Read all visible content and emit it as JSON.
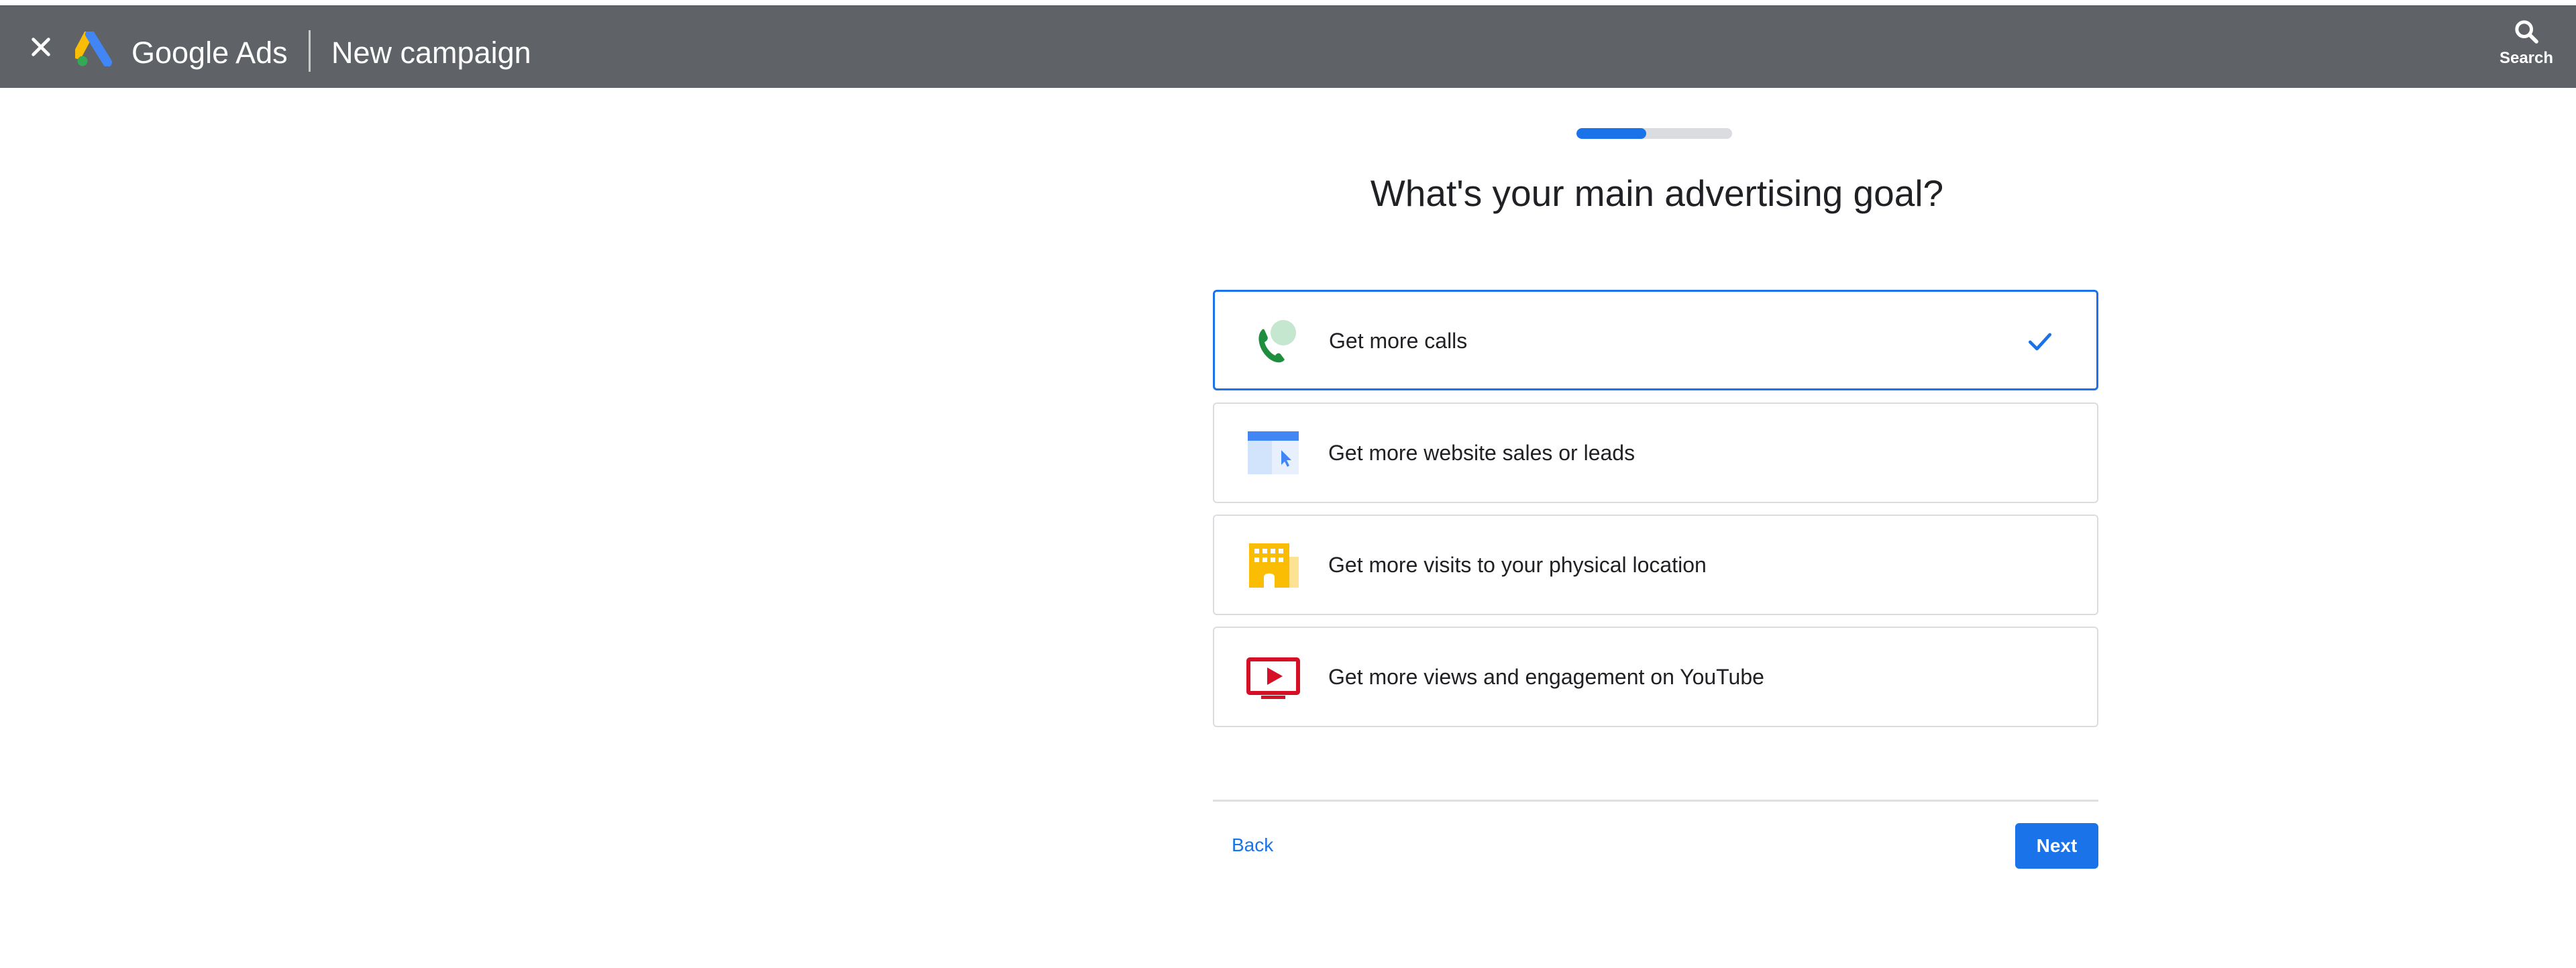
{
  "header": {
    "brand": "Google Ads",
    "title": "New campaign",
    "search_label": "Search"
  },
  "progress": {
    "fraction": 0.45
  },
  "question": "What's your main advertising goal?",
  "options": [
    {
      "label": "Get more calls",
      "icon": "phone-call-icon",
      "selected": true
    },
    {
      "label": "Get more website sales or leads",
      "icon": "website-icon",
      "selected": false
    },
    {
      "label": "Get more visits to your physical location",
      "icon": "store-building-icon",
      "selected": false
    },
    {
      "label": "Get more views and engagement on YouTube",
      "icon": "youtube-play-icon",
      "selected": false
    }
  ],
  "footer": {
    "back_label": "Back",
    "next_label": "Next"
  },
  "colors": {
    "header_bg": "#5f6368",
    "accent": "#1a73e8",
    "border": "#dadce0"
  }
}
